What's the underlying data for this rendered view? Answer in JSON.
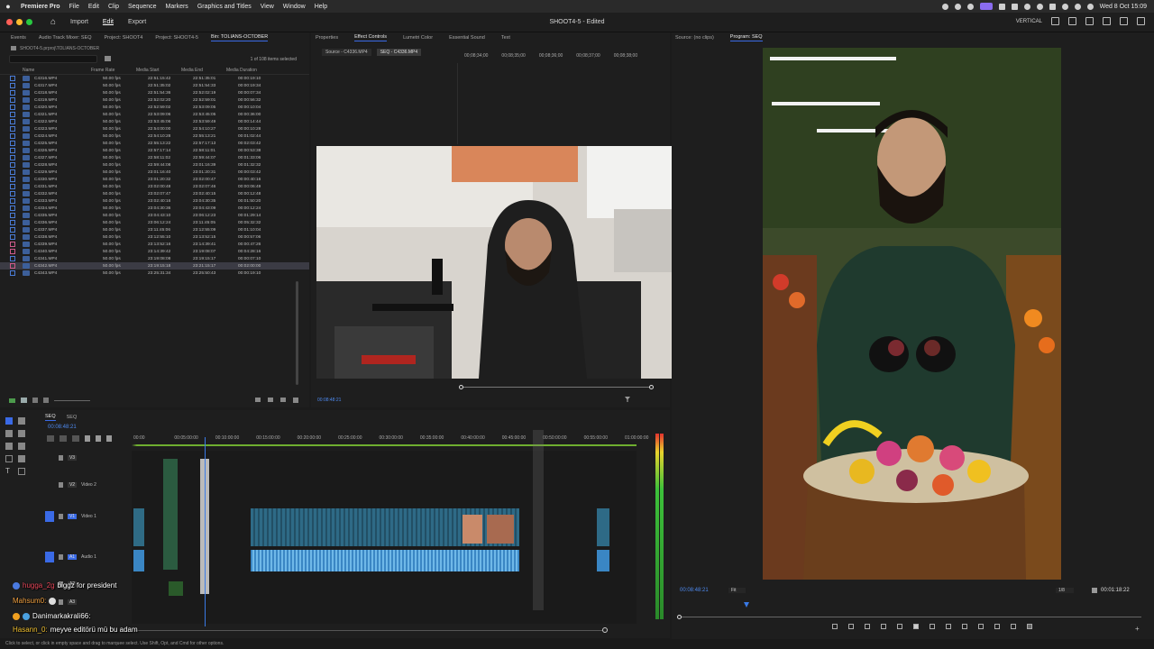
{
  "menubar": {
    "app_name": "Premiere Pro",
    "items": [
      "File",
      "Edit",
      "Clip",
      "Sequence",
      "Markers",
      "Graphics and Titles",
      "View",
      "Window",
      "Help"
    ],
    "datetime": "Wed 8 Oct  15:09"
  },
  "toolbar": {
    "home": "⌂",
    "tabs": [
      "Import",
      "Edit",
      "Export"
    ],
    "active_tab": "Edit",
    "document_title": "SHOOT4-5 - Edited",
    "vertical_label": "VERTICAL"
  },
  "project_panel": {
    "tabs": [
      "Events",
      "Audio Track Mixer: SEQ",
      "Project: SHOOT4",
      "Project: SHOOT4-5",
      "Bin: TOLIANS-OCTOBER"
    ],
    "active_tab": "Bin: TOLIANS-OCTOBER",
    "path": "SHOOT4-5.prproj\\TOLIANS-OCTOBER",
    "selection_count": "1 of 108 items selected",
    "columns": [
      "Name",
      "Frame Rate",
      "Media Start",
      "Media End",
      "Media Duration"
    ],
    "rows": [
      [
        "C4316.MP4",
        "50.00 fps",
        "22:51:15:42",
        "22:51:35:01",
        "00:00:19:10"
      ],
      [
        "C4317.MP4",
        "50.00 fps",
        "22:51:35:02",
        "22:51:54:33",
        "00:00:19:34"
      ],
      [
        "C4318.MP4",
        "50.00 fps",
        "22:51:54:36",
        "22:52:02:19",
        "00:00:07:34"
      ],
      [
        "C4319.MP4",
        "50.00 fps",
        "22:52:02:20",
        "22:52:59:01",
        "00:00:56:32"
      ],
      [
        "C4320.MP4",
        "50.00 fps",
        "22:52:59:02",
        "22:53:09:05",
        "00:00:10:04"
      ],
      [
        "C4321.MP4",
        "50.00 fps",
        "22:53:09:06",
        "22:53:45:05",
        "00:00:36:00"
      ],
      [
        "C4322.MP4",
        "50.00 fps",
        "22:53:45:06",
        "22:53:59:49",
        "00:00:14:44"
      ],
      [
        "C4323.MP4",
        "50.00 fps",
        "22:54:00:00",
        "22:54:10:27",
        "00:00:10:28"
      ],
      [
        "C4324.MP4",
        "50.00 fps",
        "22:54:10:28",
        "22:55:13:21",
        "00:01:02:44"
      ],
      [
        "C4325.MP4",
        "50.00 fps",
        "22:55:13:22",
        "22:57:17:13",
        "00:02:03:42"
      ],
      [
        "C4326.MP4",
        "50.00 fps",
        "22:57:17:14",
        "22:58:11:01",
        "00:00:53:38"
      ],
      [
        "C4327.MP4",
        "50.00 fps",
        "22:58:11:02",
        "22:59:44:07",
        "00:01:33:06"
      ],
      [
        "C4328.MP4",
        "50.00 fps",
        "22:59:44:08",
        "23:01:16:39",
        "00:01:32:32"
      ],
      [
        "C4329.MP4",
        "50.00 fps",
        "23:01:16:40",
        "23:01:20:31",
        "00:00:03:42"
      ],
      [
        "C4330.MP4",
        "50.00 fps",
        "23:01:20:32",
        "23:02:00:47",
        "00:00:40:16"
      ],
      [
        "C4331.MP4",
        "50.00 fps",
        "23:02:00:48",
        "23:02:07:46",
        "00:00:06:49"
      ],
      [
        "C4332.MP4",
        "50.00 fps",
        "23:02:07:47",
        "23:02:40:15",
        "00:00:12:48"
      ],
      [
        "C4333.MP4",
        "50.00 fps",
        "23:02:40:16",
        "23:04:30:35",
        "00:01:50:20"
      ],
      [
        "C4334.MP4",
        "50.00 fps",
        "23:04:30:36",
        "23:04:43:09",
        "00:00:12:24"
      ],
      [
        "C4335.MP4",
        "50.00 fps",
        "23:04:43:10",
        "23:06:12:23",
        "00:01:29:14"
      ],
      [
        "C4336.MP4",
        "50.00 fps",
        "23:06:12:24",
        "23:11:45:05",
        "00:05:32:32"
      ],
      [
        "C4337.MP4",
        "50.00 fps",
        "23:11:45:06",
        "23:12:55:09",
        "00:01:10:04"
      ],
      [
        "C4338.MP4",
        "50.00 fps",
        "23:12:55:10",
        "23:13:52:15",
        "00:00:57:06"
      ],
      [
        "C4339.MP4",
        "50.00 fps",
        "23:13:52:16",
        "23:14:39:41",
        "00:00:47:26"
      ],
      [
        "C4340.MP4",
        "50.00 fps",
        "23:14:39:42",
        "23:19:08:07",
        "00:04:28:16"
      ],
      [
        "C4341.MP4",
        "50.00 fps",
        "23:19:08:08",
        "23:19:15:17",
        "00:00:07:10"
      ],
      [
        "C4342.MP4",
        "50.00 fps",
        "23:19:15:18",
        "23:21:15:17",
        "00:02:00:00"
      ],
      [
        "C4343.MP4",
        "50.00 fps",
        "23:25:31:34",
        "23:25:50:43",
        "00:00:19:10"
      ]
    ]
  },
  "source_panel": {
    "tabs": [
      "Properties",
      "Effect Controls",
      "Lumetri Color",
      "Essential Sound",
      "Text"
    ],
    "active_tab": "Effect Controls",
    "source_label": "Source - C4336.MP4",
    "seq_label": "SEQ - C4336.MP4",
    "ruler": [
      "00;08;34;00",
      "00;08;35;00",
      "00;08;36;00",
      "00;08;37;00",
      "00;08;38;00"
    ],
    "timecode": "00:08:48:21"
  },
  "program_panel": {
    "tabs": [
      "Source: (no clips)",
      "Program: SEQ"
    ],
    "active_tab": "Program: SEQ",
    "timecode": "00:08:48:21",
    "fit": "Fit",
    "resolution": "1/8",
    "duration": "00:01:18:22"
  },
  "timeline": {
    "tab": "SEQ",
    "sequence": "SEQ",
    "timecode": "00:08:48:21",
    "ruler": [
      "00:00",
      "00:05:00:00",
      "00:10:00:00",
      "00:15:00:00",
      "00:20:00:00",
      "00:25:00:00",
      "00:30:00:00",
      "00:35:00:00",
      "00:40:00:00",
      "00:45:00:00",
      "00:50:00:00",
      "00:55:00:00",
      "01:00:00:00"
    ],
    "tracks": [
      {
        "id": "V3",
        "name": ""
      },
      {
        "id": "V2",
        "name": "Video 2"
      },
      {
        "id": "V1",
        "name": "Video 1"
      },
      {
        "id": "A1",
        "name": "Audio 1"
      },
      {
        "id": "A2",
        "name": ""
      },
      {
        "id": "A3",
        "name": ""
      }
    ]
  },
  "chat": [
    {
      "user": "hugga_2g",
      "text": "biggz for president",
      "color": "#e8475a"
    },
    {
      "user": "Mahsum0:",
      "text": "",
      "color": "#f0a040"
    },
    {
      "user": "Danimarkakrali66:",
      "text": "",
      "color": "#ffffff"
    },
    {
      "user": "Hasann_0:",
      "text": "meyve editörü mü bu adam",
      "color": "#f0c030"
    }
  ],
  "statusbar": {
    "text": "Click to select, or click in empty space and drag to marquee select. Use Shift, Opt, and Cmd for other options."
  }
}
